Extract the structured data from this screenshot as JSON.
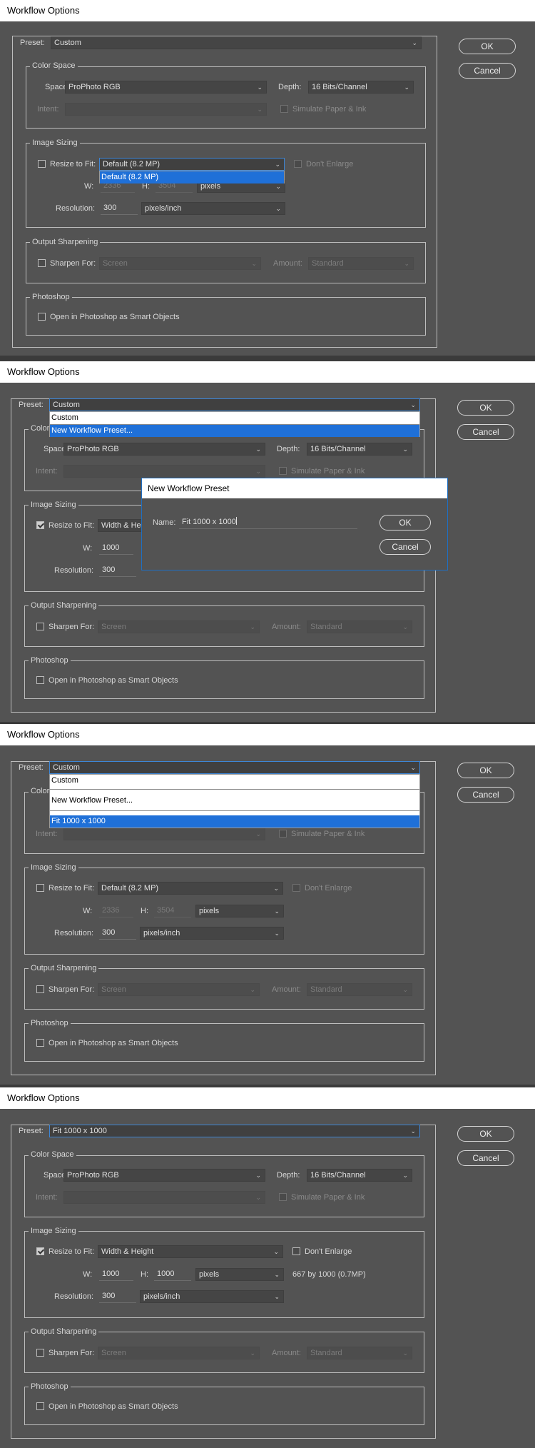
{
  "window_title": "Workflow Options",
  "labels": {
    "preset": "Preset:",
    "color_space": "Color Space",
    "space": "Space:",
    "depth": "Depth:",
    "intent": "Intent:",
    "simulate": "Simulate Paper & Ink",
    "image_sizing": "Image Sizing",
    "resize_to_fit": "Resize to Fit:",
    "dont_enlarge": "Don't Enlarge",
    "w": "W:",
    "h": "H:",
    "resolution": "Resolution:",
    "output_sharpening": "Output Sharpening",
    "sharpen_for": "Sharpen For:",
    "amount": "Amount:",
    "photoshop": "Photoshop",
    "open_smart": "Open in Photoshop as Smart Objects"
  },
  "buttons": {
    "ok": "OK",
    "cancel": "Cancel"
  },
  "values": {
    "space": "ProPhoto RGB",
    "depth": "16 Bits/Channel",
    "intent": "",
    "width_default": "2336",
    "height_default": "3504",
    "width_fit": "1000",
    "height_fit": "1000",
    "units": "pixels",
    "resolution": "300",
    "res_units": "pixels/inch",
    "sharpen_for": "Screen",
    "amount": "Standard",
    "size_info": "667 by 1000 (0.7MP)"
  },
  "panels": [
    {
      "preset": "Custom",
      "resize_value": "Default  (8.2 MP)",
      "resize_options": [
        "Default  (8.2 MP)"
      ]
    },
    {
      "preset": "Custom",
      "resize_value": "Width & Height",
      "preset_options": [
        "Custom",
        "New Workflow Preset..."
      ],
      "new_preset_dialog": {
        "title": "New Workflow Preset",
        "name_label": "Name:",
        "name_value": "Fit 1000 x 1000"
      }
    },
    {
      "preset": "Custom",
      "resize_value": "Default  (8.2 MP)",
      "preset_options": [
        "Custom",
        "New Workflow Preset...",
        "Fit 1000 x 1000"
      ]
    },
    {
      "preset": "Fit 1000 x 1000",
      "resize_value": "Width & Height"
    }
  ]
}
